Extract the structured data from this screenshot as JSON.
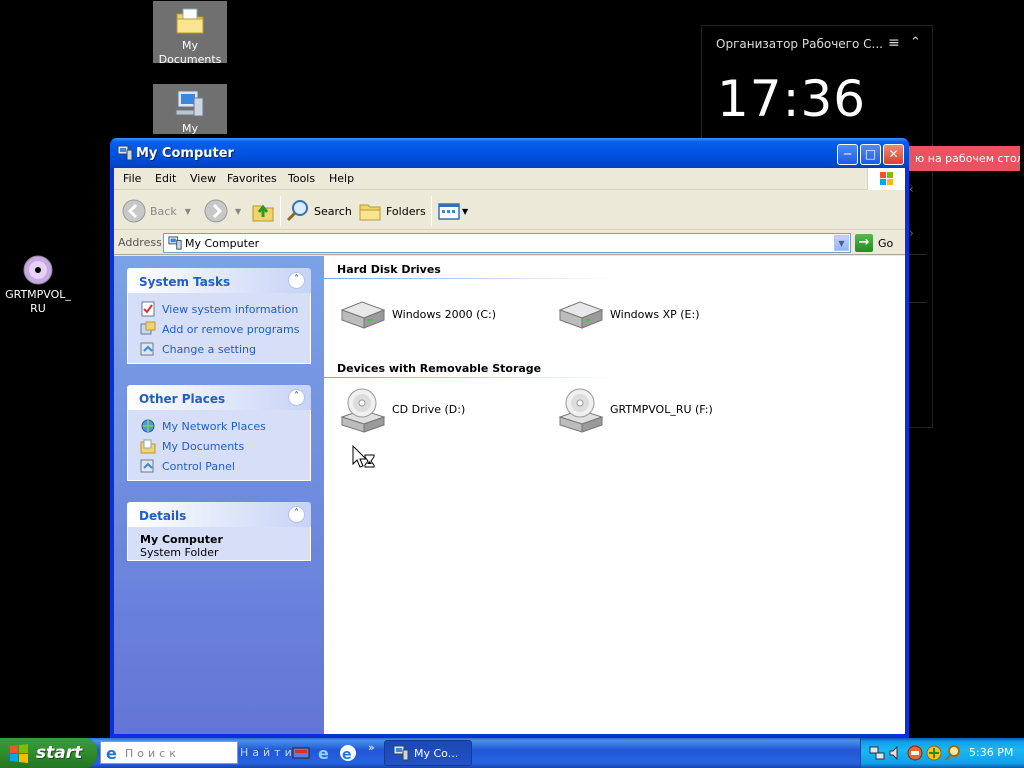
{
  "desktop": {
    "icons": [
      {
        "label": "My Documents",
        "icon": "my-documents-icon"
      },
      {
        "label": "My Computer",
        "icon": "my-computer-icon"
      },
      {
        "label": "GRTMPVOL_RU",
        "icon": "cd-disc-icon"
      }
    ],
    "widget": {
      "title": "Организатор Рабочего С...",
      "clock": "17:36",
      "tag": "ю на рабочем столе"
    }
  },
  "window": {
    "title": "My Computer",
    "menu": [
      "File",
      "Edit",
      "View",
      "Favorites",
      "Tools",
      "Help"
    ],
    "toolbar": {
      "back": "Back",
      "search": "Search",
      "folders": "Folders"
    },
    "address": {
      "label": "Address",
      "value": "My Computer",
      "go": "Go"
    },
    "left_pane": {
      "system_tasks": {
        "title": "System Tasks",
        "items": [
          "View system information",
          "Add or remove programs",
          "Change a setting"
        ]
      },
      "other_places": {
        "title": "Other Places",
        "items": [
          "My Network Places",
          "My Documents",
          "Control Panel"
        ]
      },
      "details": {
        "title": "Details",
        "name": "My Computer",
        "type": "System Folder"
      }
    },
    "groups": {
      "hard_disks": {
        "title": "Hard Disk Drives",
        "drives": [
          "Windows 2000 (C:)",
          "Windows XP (E:)"
        ]
      },
      "removable": {
        "title": "Devices with Removable Storage",
        "drives": [
          "CD Drive (D:)",
          "GRTMPVOL_RU (F:)"
        ]
      }
    }
  },
  "taskbar": {
    "start": "start",
    "search_placeholder": "Поиск",
    "find_label": "Найти",
    "task_button": "My Co...",
    "time": "5:36 PM"
  },
  "colors": {
    "xp_blue": "#0054e3",
    "task_link": "#215dc6",
    "start_green": "#2f8c2f",
    "tray_blue": "#139ee9",
    "tag_red": "#e9525e"
  }
}
